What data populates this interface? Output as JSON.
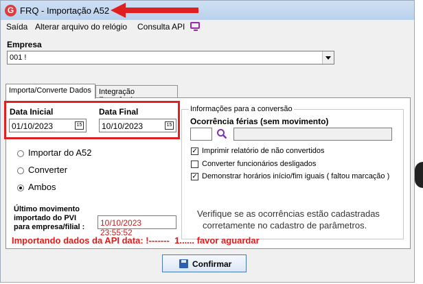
{
  "window": {
    "title": "FRQ - Importação A52",
    "app_icon_letter": "G"
  },
  "menu": {
    "items": [
      "Saída",
      "Alterar arquivo do relógio",
      "Consulta API"
    ],
    "monitor_icon": "monitor-icon"
  },
  "empresa": {
    "label": "Empresa",
    "value": "001 !"
  },
  "tabs": [
    {
      "label": "Importa/Converte Dados",
      "active": true
    },
    {
      "label": "Integração Frequência",
      "active": false
    }
  ],
  "dates": {
    "inicial_label": "Data Inicial",
    "inicial_value": "01/10/2023",
    "final_label": "Data Final",
    "final_value": "10/10/2023",
    "calendar_icon_text": "15"
  },
  "modes": {
    "options": [
      "Importar do A52",
      "Converter",
      "Ambos"
    ],
    "selected": "Ambos"
  },
  "ultimo": {
    "label_line1": "Último movimento",
    "label_line2": "importado do PVI",
    "label_line3": "para empresa/filial :",
    "value": "10/10/2023  23:55:52"
  },
  "info": {
    "group_title": "Informações para a conversão",
    "ocorrencia_label": "Ocorrência férias (sem movimento)",
    "checks": [
      {
        "label": "Imprimir relatório de não convertidos",
        "checked": true
      },
      {
        "label": "Converter funcionários desligados",
        "checked": false
      },
      {
        "label": "Demonstrar horários início/fim iguais ( faltou marcação )",
        "checked": true
      }
    ],
    "note_line1": "Verifique se as ocorrências estão cadastradas",
    "note_line2": "corretamente  no cadastro de parâmetros."
  },
  "status": {
    "text": "Importando dados da API data: !-------  1...... favor aguardar"
  },
  "confirm": {
    "label": "Confirmar"
  },
  "colors": {
    "highlight_red": "#e02020",
    "status_red": "#e01a1a",
    "accent_purple": "#9b27b0"
  }
}
